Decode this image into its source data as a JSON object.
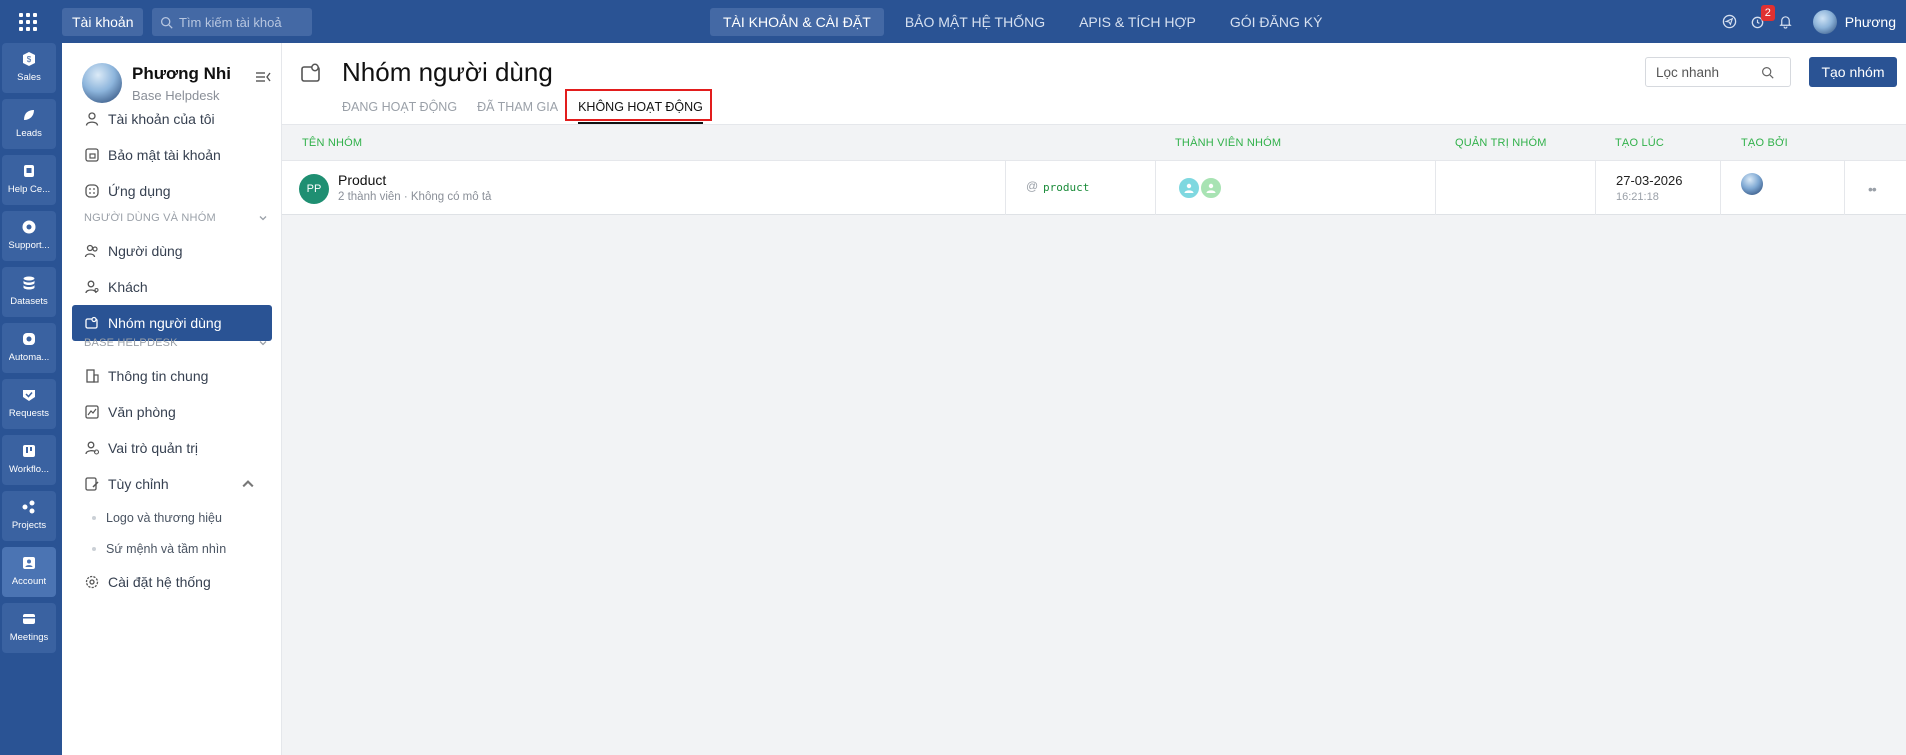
{
  "topbar": {
    "account_label": "Tài khoản",
    "search_placeholder": "Tìm kiếm tài khoả",
    "nav": [
      "TÀI KHOẢN & CÀI ĐẶT",
      "BẢO MẬT HỆ THỐNG",
      "APIS & TÍCH HỢP",
      "GÓI ĐĂNG KÝ"
    ],
    "notification_count": "2",
    "user_name": "Phương"
  },
  "rail": [
    "Sales",
    "Leads",
    "Help Ce...",
    "Support...",
    "Datasets",
    "Automa...",
    "Requests",
    "Workflo...",
    "Projects",
    "Account",
    "Meetings"
  ],
  "panel": {
    "name": "Phương Nhi",
    "org": "Base Helpdesk",
    "items_top": [
      "Tài khoản của tôi",
      "Bảo mật tài khoản",
      "Ứng dụng"
    ],
    "section_users": "NGƯỜI DÙNG VÀ NHÓM",
    "items_users": [
      "Người dùng",
      "Khách",
      "Nhóm người dùng"
    ],
    "section_helpdesk": "BASE HELPDESK",
    "items_helpdesk": [
      "Thông tin chung",
      "Văn phòng",
      "Vai trò quản trị",
      "Tùy chỉnh"
    ],
    "sub_items": [
      "Logo và thương hiệu",
      "Sứ mệnh và tầm nhìn"
    ],
    "settings": "Cài đặt hệ thống"
  },
  "main": {
    "title": "Nhóm người dùng",
    "tabs": [
      "ĐANG HOẠT ĐỘNG",
      "ĐÃ THAM GIA",
      "KHÔNG HOẠT ĐỘNG"
    ],
    "filter_placeholder": "Lọc nhanh",
    "create_label": "Tạo nhóm",
    "columns": [
      "TÊN NHÓM",
      "THÀNH VIÊN NHÓM",
      "QUẢN TRỊ NHÓM",
      "TẠO LÚC",
      "TẠO BỞI"
    ],
    "rows": [
      {
        "initials": "PP",
        "name": "Product",
        "meta": "2 thành viên · Không có mô tả",
        "mention": "@",
        "alias": "product",
        "date": "27-03-2026",
        "time": "16:21:18",
        "more": "••"
      }
    ]
  },
  "colors": {
    "brand": "#2a5394",
    "header_green": "#31b14a",
    "highlight_red": "#e21d1d",
    "avatar_teal": "#1f8f72"
  }
}
